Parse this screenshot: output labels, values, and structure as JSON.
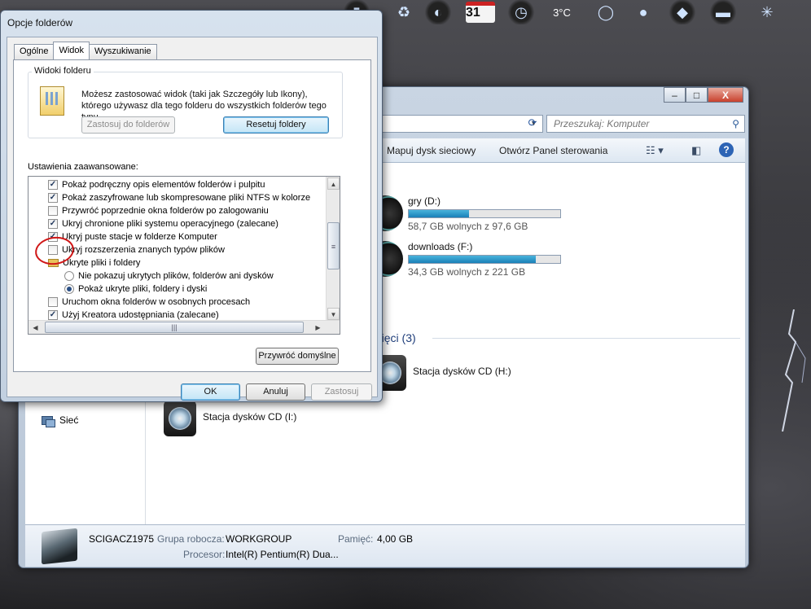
{
  "dock": {
    "calendar_day": "31",
    "temperature": "3°C"
  },
  "explorer": {
    "window_buttons": {
      "minimize": "–",
      "maximize": "□",
      "close": "X"
    },
    "search_placeholder": "Przeszukaj: Komputer",
    "toolbar": {
      "map_drive": "Mapuj dysk sieciowy",
      "control_panel": "Otwórz Panel sterowania"
    },
    "nav": {
      "network": "Sieć"
    },
    "drives": [
      {
        "name": "gry (D:)",
        "free": "58,7 GB wolnych z 97,6 GB",
        "used_fraction": 0.4
      },
      {
        "name": "downloads (F:)",
        "free": "34,3 GB wolnych z 221 GB",
        "used_fraction": 0.84
      }
    ],
    "removable_header": "mięci (3)",
    "cd_drives": [
      {
        "name": "Stacja dysków CD (H:)"
      },
      {
        "name": "Stacja dysków CD (I:)"
      }
    ],
    "details": {
      "computer_name": "SCIGACZ1975",
      "workgroup_label": "Grupa robocza:",
      "workgroup": "WORKGROUP",
      "memory_label": "Pamięć:",
      "memory": "4,00 GB",
      "processor_label": "Procesor:",
      "processor": "Intel(R) Pentium(R) Dua..."
    }
  },
  "dialog": {
    "title": "Opcje folderów",
    "tabs": [
      "Ogólne",
      "Widok",
      "Wyszukiwanie"
    ],
    "active_tab": "Widok",
    "folder_views": {
      "title": "Widoki folderu",
      "description": "Możesz zastosować widok (taki jak Szczegóły lub Ikony), którego używasz dla tego folderu do wszystkich folderów tego typu.",
      "apply_button": "Zastosuj do folderów",
      "reset_button": "Resetuj foldery"
    },
    "advanced_label": "Ustawienia zaawansowane:",
    "settings": [
      {
        "type": "checkbox",
        "checked": true,
        "label": "Pokaż podręczny opis elementów folderów i pulpitu"
      },
      {
        "type": "checkbox",
        "checked": true,
        "label": "Pokaż zaszyfrowane lub skompresowane pliki NTFS w kolorze"
      },
      {
        "type": "checkbox",
        "checked": false,
        "label": "Przywróć poprzednie okna folderów po zalogowaniu"
      },
      {
        "type": "checkbox",
        "checked": true,
        "label": "Ukryj chronione pliki systemu operacyjnego (zalecane)"
      },
      {
        "type": "checkbox",
        "checked": true,
        "label": "Ukryj puste stacje w folderze Komputer"
      },
      {
        "type": "checkbox",
        "checked": false,
        "label": "Ukryj rozszerzenia znanych typów plików"
      },
      {
        "type": "folder",
        "label": "Ukryte pliki i foldery"
      },
      {
        "type": "radio",
        "checked": false,
        "label": "Nie pokazuj ukrytych plików, folderów ani dysków"
      },
      {
        "type": "radio",
        "checked": true,
        "label": "Pokaż ukryte pliki, foldery i dyski"
      },
      {
        "type": "checkbox",
        "checked": false,
        "label": "Uruchom okna folderów w osobnych procesach"
      },
      {
        "type": "checkbox",
        "checked": true,
        "label": "Użyj Kreatora udostępniania (zalecane)"
      }
    ],
    "restore_defaults": "Przywróć domyślne",
    "ok": "OK",
    "cancel": "Anuluj",
    "apply": "Zastosuj"
  }
}
